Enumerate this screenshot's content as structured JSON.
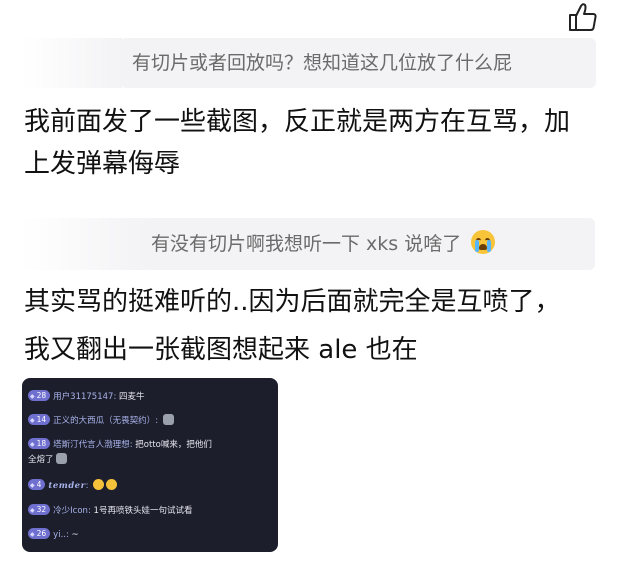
{
  "quotes": [
    {
      "text": "有切片或者回放吗？想知道这几位放了什么屁"
    },
    {
      "text": "有没有切片啊我想听一下 xks 说啥了"
    }
  ],
  "replies": [
    {
      "line1": "我前面发了一些截图，反正就是两方在互骂，加",
      "line2": "上发弹幕侮辱"
    },
    {
      "line1": "其实骂的挺难听的..因为后面就完全是互喷了，",
      "line2": "我又翻出一张截图想起来 ale 也在"
    }
  ],
  "chat_screenshot": {
    "messages": [
      {
        "level": "28",
        "user": "用户31175147",
        "text": "四麦牛"
      },
      {
        "level": "14",
        "user": "正义的大西瓜（无畏契约）",
        "text": ""
      },
      {
        "level": "18",
        "user": "塔斯汀代言人渤理想",
        "text": "把otto喊来，把他们",
        "text2": "全熔了"
      },
      {
        "level": "4",
        "user": "temder",
        "text": ""
      },
      {
        "level": "32",
        "user": "冷少Icon",
        "text": "1号再喷铁头娃一句试试看"
      },
      {
        "level": "26",
        "user": "yi..",
        "text": "~"
      }
    ]
  },
  "icons": {
    "like": "thumbs-up-icon",
    "quote_emoji": "crying-emoji-icon"
  }
}
